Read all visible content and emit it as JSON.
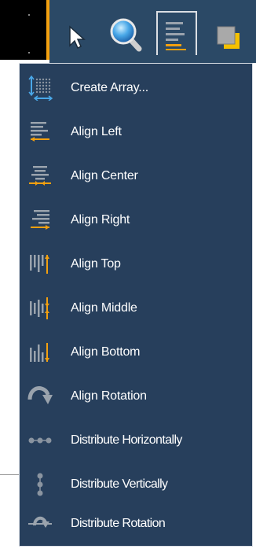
{
  "colors": {
    "toolbar_bg": "#2b4966",
    "menu_bg": "#273f5c",
    "menu_border": "#d8dde4",
    "accent_orange": "#f3a00f",
    "accent_blue": "#4aa8e8",
    "icon_gray": "#8a94a0"
  },
  "toolbar": {
    "tools": [
      {
        "icon": "pointer-icon"
      },
      {
        "icon": "zoom-icon"
      },
      {
        "icon": "align-left-icon",
        "active": true
      },
      {
        "icon": "layers-icon"
      }
    ]
  },
  "menu": {
    "items": [
      {
        "label": "Create Array...",
        "icon": "create-array-icon"
      },
      {
        "label": "Align Left",
        "icon": "align-left-icon"
      },
      {
        "label": "Align Center",
        "icon": "align-center-icon"
      },
      {
        "label": "Align Right",
        "icon": "align-right-icon"
      },
      {
        "label": "Align Top",
        "icon": "align-top-icon"
      },
      {
        "label": "Align Middle",
        "icon": "align-middle-icon"
      },
      {
        "label": "Align Bottom",
        "icon": "align-bottom-icon"
      },
      {
        "label": "Align Rotation",
        "icon": "align-rotation-icon"
      },
      {
        "label": "Distribute Horizontally",
        "icon": "distribute-horizontally-icon"
      },
      {
        "label": "Distribute Vertically",
        "icon": "distribute-vertically-icon"
      },
      {
        "label": "Distribute Rotation",
        "icon": "distribute-rotation-icon"
      }
    ]
  }
}
